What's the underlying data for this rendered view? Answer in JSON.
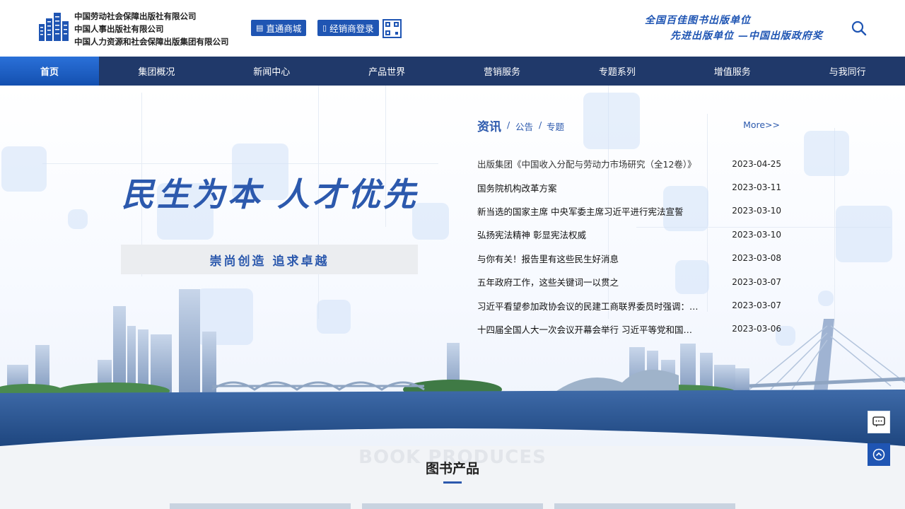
{
  "header": {
    "org_names": [
      "中国劳动社会保障出版社有限公司",
      "中国人事出版社有限公司",
      "中国人力资源和社会保障出版集团有限公司"
    ],
    "mall_button": "直通商城",
    "dealer_button": "经销商登录",
    "slogan_line1": "全国百佳图书出版单位",
    "slogan_line2": "先进出版单位 —中国出版政府奖"
  },
  "nav": {
    "items": [
      "首页",
      "集团概况",
      "新闻中心",
      "产品世界",
      "营销服务",
      "专题系列",
      "增值服务",
      "与我同行"
    ]
  },
  "hero": {
    "title": "民生为本 人才优先",
    "subtitle": "崇尚创造   追求卓越"
  },
  "news": {
    "tab_main": "资讯",
    "tab_notice": "公告",
    "tab_topic": "专题",
    "separator": "/",
    "more": "More>>",
    "items": [
      {
        "title": "出版集团《中国收入分配与劳动力市场研究（全12卷）》",
        "date": "2023-04-25"
      },
      {
        "title": "国务院机构改革方案",
        "date": "2023-03-11"
      },
      {
        "title": "新当选的国家主席 中央军委主席习近平进行宪法宣誓",
        "date": "2023-03-10"
      },
      {
        "title": "弘扬宪法精神 彰显宪法权威",
        "date": "2023-03-10"
      },
      {
        "title": "与你有关！报告里有这些民生好消息",
        "date": "2023-03-08"
      },
      {
        "title": "五年政府工作，这些关键词一以贯之",
        "date": "2023-03-07"
      },
      {
        "title": "习近平看望参加政协会议的民建工商联界委员时强调：正确",
        "date": "2023-03-07"
      },
      {
        "title": "十四届全国人大一次会议开幕会举行 习近平等党和国家领导人",
        "date": "2023-03-06"
      }
    ]
  },
  "products": {
    "watermark": "BOOK PRODUCES",
    "title": "图书产品"
  },
  "colors": {
    "brand_blue": "#1f55b3",
    "nav_bg": "#20396a",
    "nav_active": "#1a5fcf"
  }
}
